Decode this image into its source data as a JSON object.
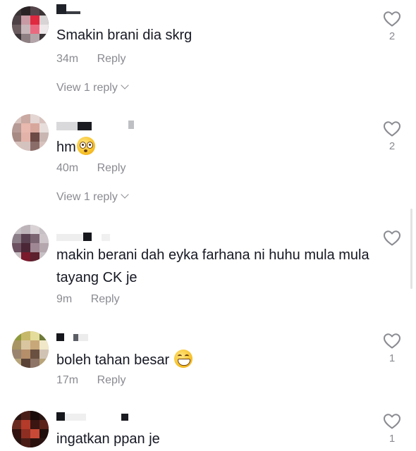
{
  "comments": [
    {
      "username": "",
      "text": "Smakin brani dia skrg",
      "emoji": "",
      "time": "34m",
      "reply_label": "Reply",
      "view_replies": "View 1 reply",
      "likes": "2"
    },
    {
      "username": "",
      "text": "hm",
      "emoji": "flushed-face",
      "time": "40m",
      "reply_label": "Reply",
      "view_replies": "View 1 reply",
      "likes": "2"
    },
    {
      "username": "",
      "text": "makin berani dah eyka farhana ni huhu mula mula tayang CK je",
      "emoji": "",
      "time": "9m",
      "reply_label": "Reply",
      "view_replies": "",
      "likes": ""
    },
    {
      "username": "",
      "text": "boleh tahan besar",
      "emoji": "grinning-face",
      "time": "17m",
      "reply_label": "Reply",
      "view_replies": "",
      "likes": "1"
    },
    {
      "username": "",
      "text": "ingatkan ppan je",
      "emoji": "",
      "time": "",
      "reply_label": "",
      "view_replies": "",
      "likes": "1"
    }
  ],
  "colors": {
    "text_primary": "#161823",
    "text_secondary": "#8a8b91",
    "background": "#ffffff"
  },
  "icons": {
    "like": "heart-outline-icon",
    "expand": "chevron-down-icon"
  }
}
